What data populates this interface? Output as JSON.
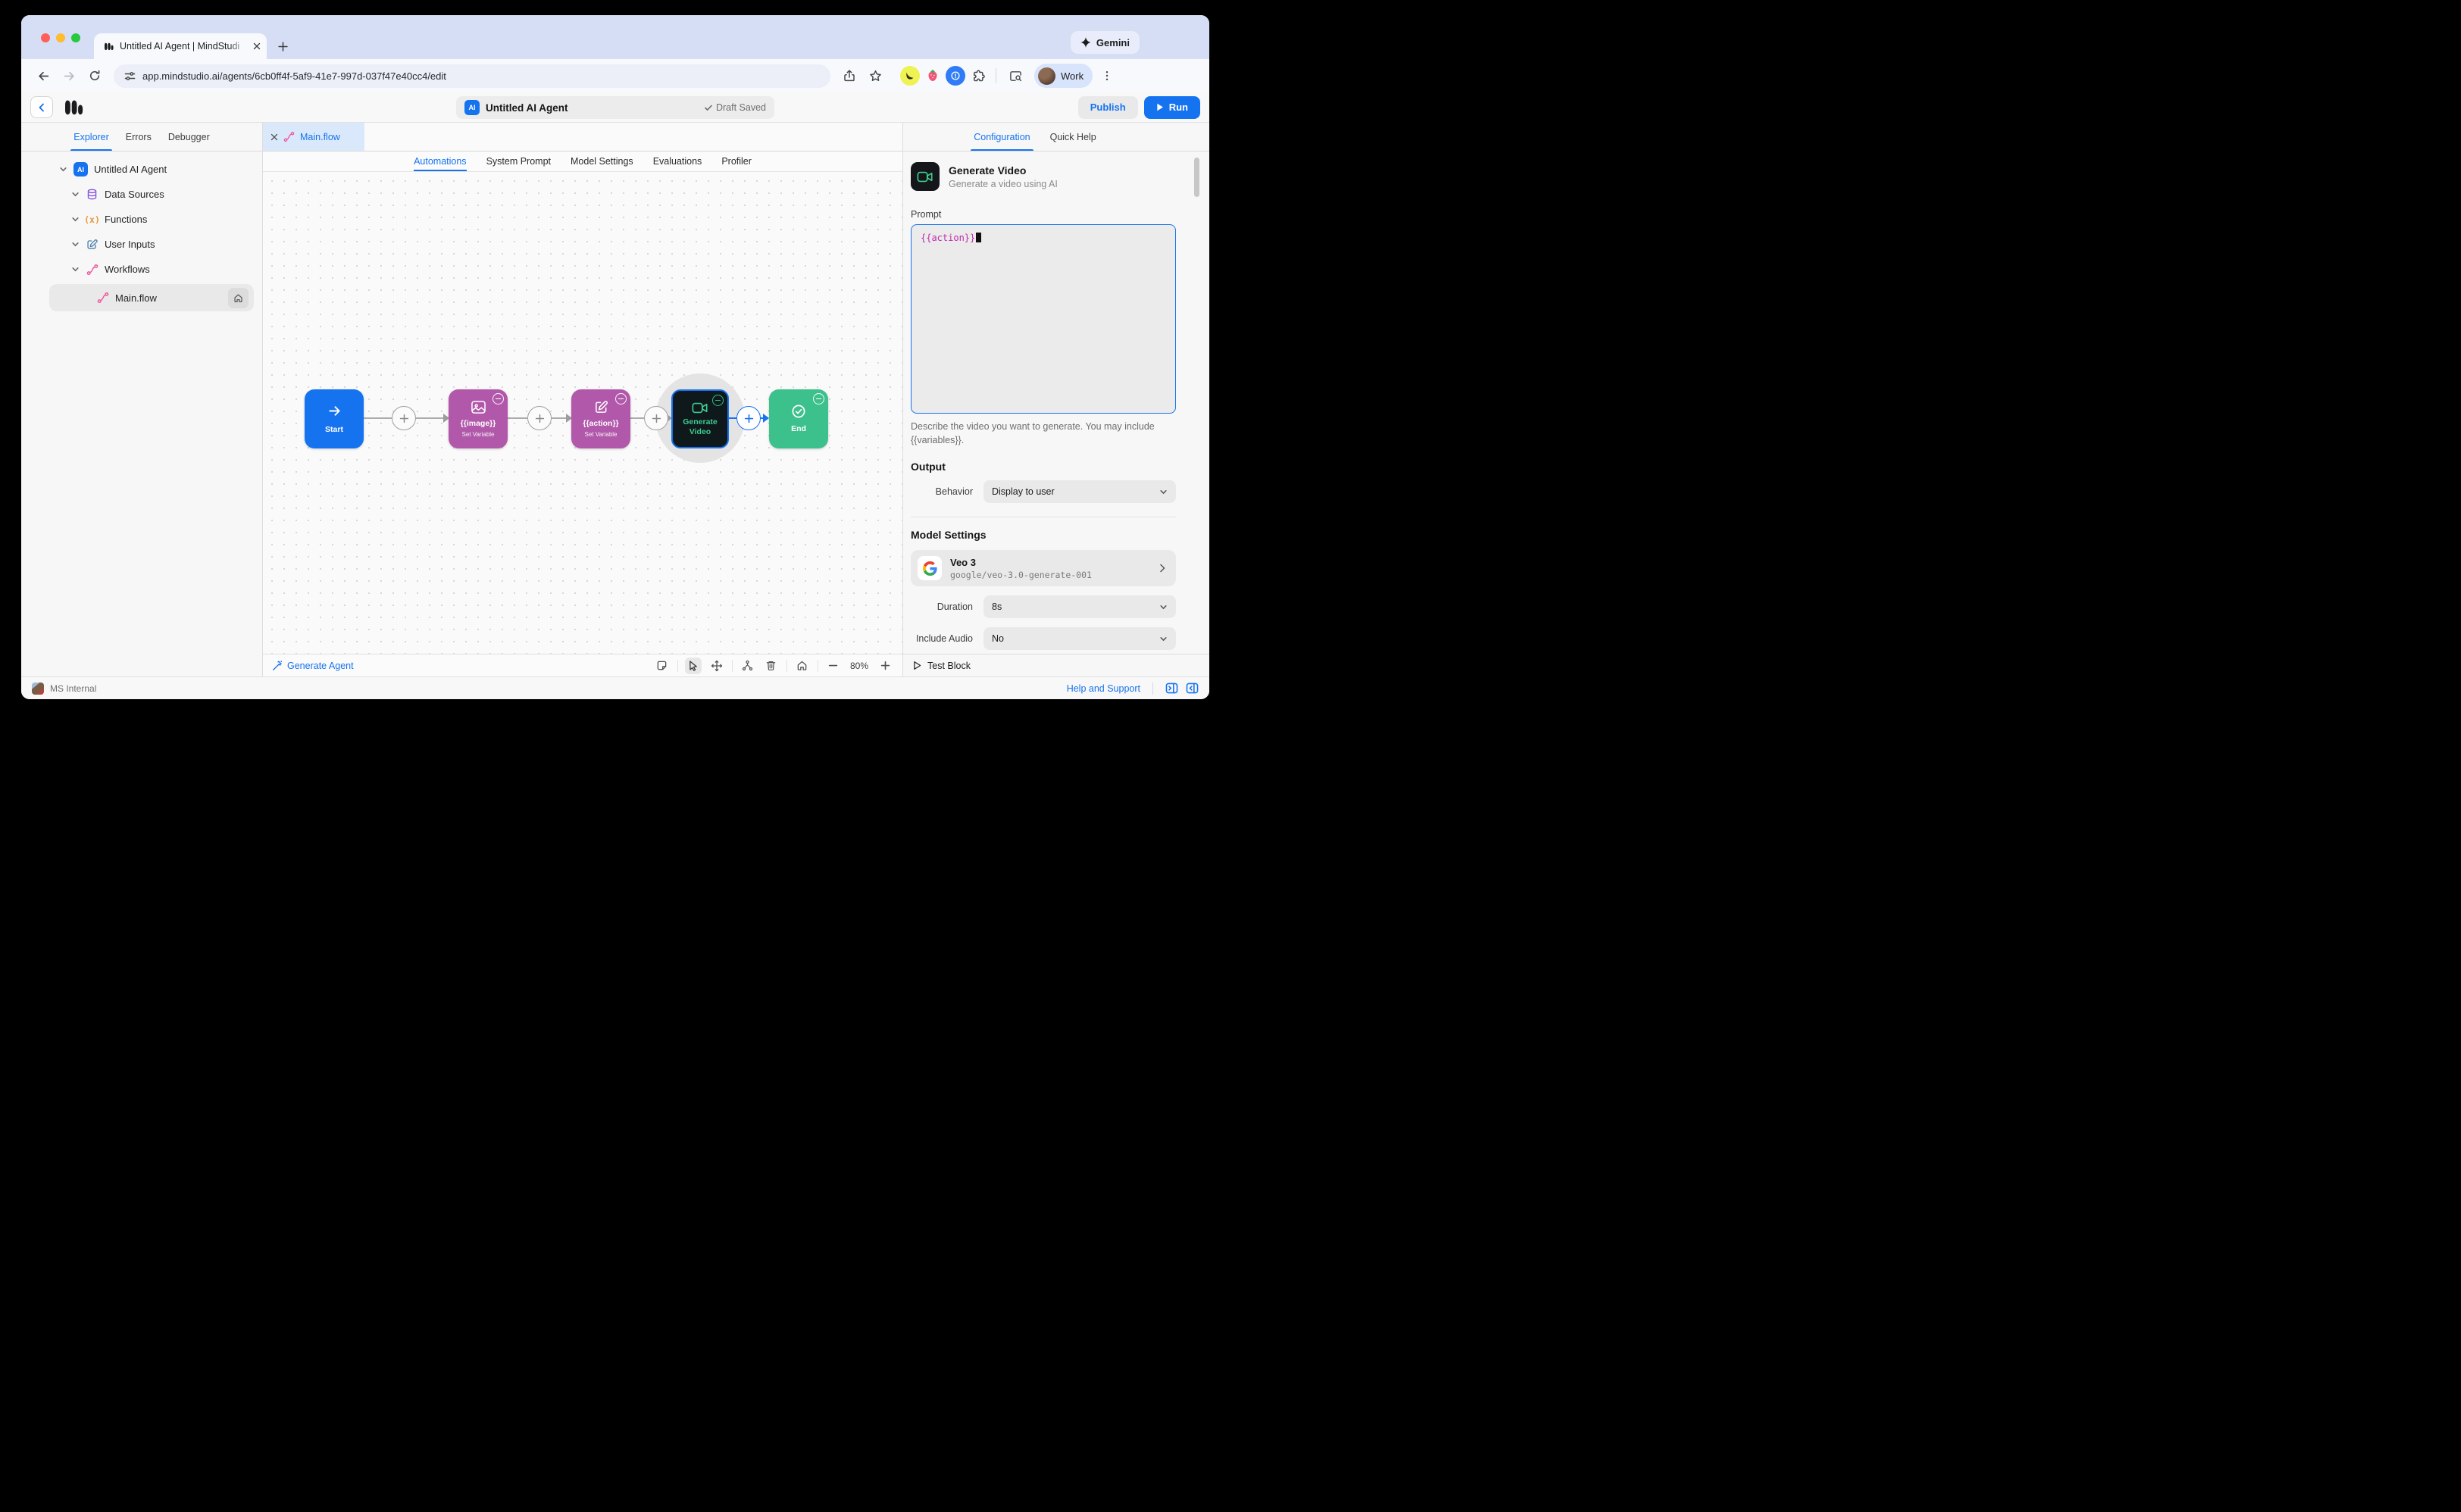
{
  "browser": {
    "tab_title": "Untitled AI Agent | MindStudi",
    "gemini_label": "Gemini",
    "url": "app.mindstudio.ai/agents/6cb0ff4f-5af9-41e7-997d-037f47e40cc4/edit",
    "profile_label": "Work"
  },
  "header": {
    "agent_badge": "AI",
    "title": "Untitled AI Agent",
    "draft_status": "Draft Saved",
    "publish_label": "Publish",
    "run_label": "Run"
  },
  "sidebar": {
    "tabs": [
      {
        "label": "Explorer"
      },
      {
        "label": "Errors"
      },
      {
        "label": "Debugger"
      }
    ],
    "tree": [
      {
        "label": "Untitled AI Agent"
      },
      {
        "label": "Data Sources"
      },
      {
        "label": "Functions"
      },
      {
        "label": "User Inputs"
      },
      {
        "label": "Workflows"
      },
      {
        "label": "Main.flow"
      }
    ]
  },
  "canvas": {
    "file_tab": "Main.flow",
    "tabs": [
      "Automations",
      "System Prompt",
      "Model Settings",
      "Evaluations",
      "Profiler"
    ],
    "nodes": {
      "start": {
        "label": "Start"
      },
      "image": {
        "label": "{{image}}",
        "sublabel": "Set Variable"
      },
      "action": {
        "label": "{{action}}",
        "sublabel": "Set Variable"
      },
      "generate_video": {
        "label": "Generate Video"
      },
      "end": {
        "label": "End"
      }
    },
    "toolbar": {
      "generate_agent": "Generate Agent",
      "zoom": "80%"
    }
  },
  "panel": {
    "tabs": [
      {
        "label": "Configuration"
      },
      {
        "label": "Quick Help"
      }
    ],
    "block_title": "Generate Video",
    "block_subtitle": "Generate a video using AI",
    "prompt_label": "Prompt",
    "prompt_value": "{{action}}",
    "prompt_help": "Describe the video you want to generate. You may include {{variables}}.",
    "output_heading": "Output",
    "behavior_label": "Behavior",
    "behavior_value": "Display to user",
    "model_settings_heading": "Model Settings",
    "model_name": "Veo 3",
    "model_id": "google/veo-3.0-generate-001",
    "duration_label": "Duration",
    "duration_value": "8s",
    "include_audio_label": "Include Audio",
    "include_audio_value": "No",
    "test_block_label": "Test Block"
  },
  "statusbar": {
    "workspace": "MS Internal",
    "help_label": "Help and Support"
  },
  "colors": {
    "accent_blue": "#1673f0",
    "node_purple": "#b158aa",
    "node_green": "#3cc08c",
    "node_dark": "#0f191b",
    "flow_pink": "#ee5a9e",
    "code_magenta": "#bf2cab"
  }
}
